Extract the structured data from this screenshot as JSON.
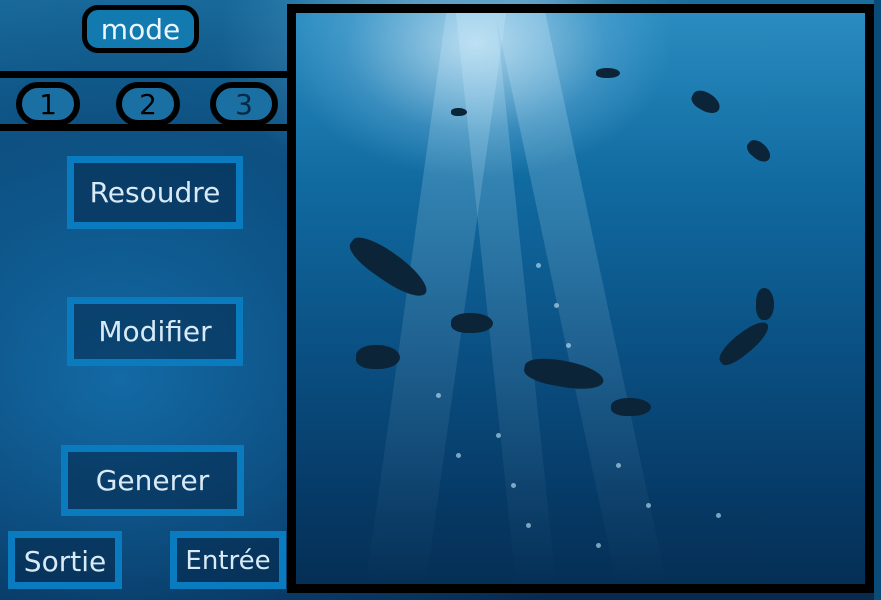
{
  "header": {
    "mode_label": "mode"
  },
  "levels": [
    {
      "label": "1"
    },
    {
      "label": "2"
    },
    {
      "label": "3"
    }
  ],
  "actions": {
    "resoudre": "Resoudre",
    "modifier": "Modifier",
    "generer": "Generer",
    "sortie": "Sortie",
    "entree": "Entrée"
  },
  "colors": {
    "button_border": "#0b7bbf",
    "frame_border": "#000000",
    "background": "#0d5686"
  }
}
